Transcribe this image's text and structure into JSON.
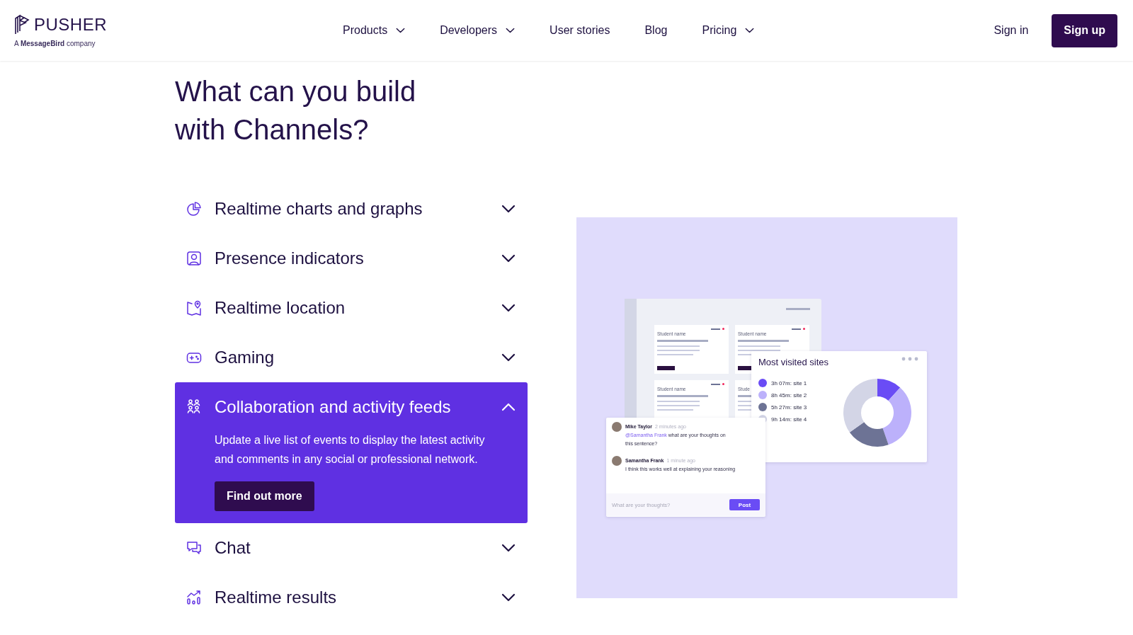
{
  "header": {
    "logo": {
      "name": "PUSHER",
      "tagline": "A **MessageBird** company"
    },
    "nav": [
      {
        "label": "Products",
        "dropdown": true
      },
      {
        "label": "Developers",
        "dropdown": true
      },
      {
        "label": "User stories",
        "dropdown": false
      },
      {
        "label": "Blog",
        "dropdown": false
      },
      {
        "label": "Pricing",
        "dropdown": true
      }
    ],
    "sign_in": "Sign in",
    "sign_up": "Sign up"
  },
  "title": "What can you build with Channels?",
  "features": [
    {
      "title": "Realtime charts and graphs",
      "expanded": false
    },
    {
      "title": "Presence indicators",
      "expanded": false
    },
    {
      "title": "Realtime location",
      "expanded": false
    },
    {
      "title": "Gaming",
      "expanded": false
    },
    {
      "title": "Collaboration and activity feeds",
      "expanded": true,
      "description": "Update a live list of events to display the latest activity and comments in any social or professional network.",
      "cta": "Find out more"
    },
    {
      "title": "Chat",
      "expanded": false
    },
    {
      "title": "Realtime results",
      "expanded": false
    }
  ],
  "illustration": {
    "dashboard": {
      "cards": [
        {
          "label": "Student name"
        },
        {
          "label": "Student name"
        },
        {
          "label": "Student name"
        },
        {
          "label": "Stude"
        }
      ]
    },
    "sites_card": {
      "title": "Most visited sites",
      "legend": [
        {
          "label": "3h 07m: site 1",
          "color": "#6a4cf5"
        },
        {
          "label": "8h 45m: site 2",
          "color": "#bcb1fb"
        },
        {
          "label": "5h 27m: site 3",
          "color": "#6d7395"
        },
        {
          "label": "9h 14m: site 4",
          "color": "#d3d5e6"
        }
      ],
      "chart_data": {
        "type": "donut",
        "values": [
          11.7,
          33.0,
          20.5,
          34.8
        ]
      }
    },
    "chat_card": {
      "comments": [
        {
          "author": "Mike Taylor",
          "time": "2 minutes ago",
          "mention": "@Samantha Frank",
          "text": "what are your thoughts on this sentence?"
        },
        {
          "author": "Samantha Frank",
          "time": "1 minute ago",
          "text": "I think this works well at explaining your reasoning"
        }
      ],
      "input": {
        "placeholder": "What are your thoughts?"
      },
      "button": "Post"
    }
  }
}
